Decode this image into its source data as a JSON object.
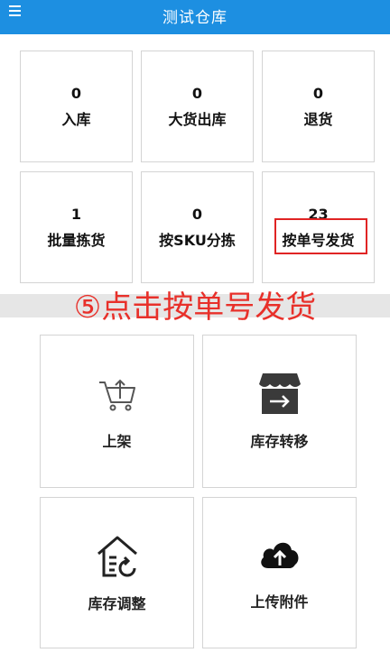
{
  "header": {
    "title": "测试仓库",
    "menu_icon": "menu-icon"
  },
  "tiles": [
    {
      "count": "0",
      "label": "入库"
    },
    {
      "count": "0",
      "label": "大货出库"
    },
    {
      "count": "0",
      "label": "退货"
    },
    {
      "count": "1",
      "label": "批量拣货"
    },
    {
      "count": "0",
      "label": "按SKU分拣"
    },
    {
      "count": "23",
      "label": "按单号发货"
    }
  ],
  "annotation": {
    "text": "⑤点击按单号发货",
    "color": "#e8302a"
  },
  "functions": [
    {
      "label": "上架",
      "icon": "cart-upload-icon"
    },
    {
      "label": "库存转移",
      "icon": "store-transfer-icon"
    },
    {
      "label": "库存调整",
      "icon": "house-adjust-icon"
    },
    {
      "label": "上传附件",
      "icon": "cloud-upload-icon"
    }
  ],
  "colors": {
    "header": "#1d8fe1",
    "highlight": "#e02424"
  }
}
